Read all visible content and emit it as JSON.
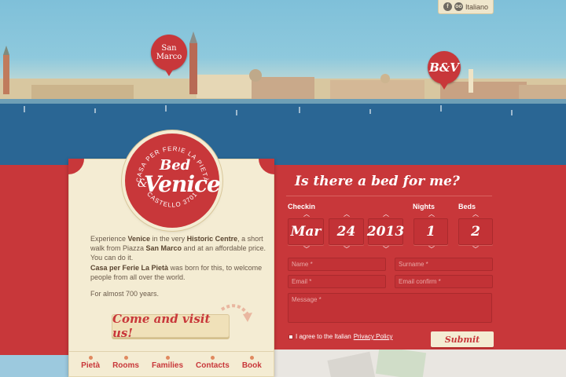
{
  "header": {
    "language": "Italiano",
    "social": [
      {
        "icon": "facebook-icon",
        "glyph": "f"
      },
      {
        "icon": "tripadvisor-icon",
        "glyph": "oo"
      }
    ]
  },
  "map_pins": {
    "san_marco": "San Marco",
    "bv": "B&V"
  },
  "logo": {
    "arc_top": "CASA PER FERIE LA PIETÀ",
    "bed": "Bed",
    "amp": "&",
    "venice": "Venice",
    "arc_bottom": "CASTELLO 3701"
  },
  "intro": {
    "p1_a": "Experience ",
    "p1_b": "Venice",
    "p1_c": " in the very ",
    "p1_d": "Historic Centre",
    "p1_e": ", a short walk from Piazza ",
    "p1_f": "San Marco",
    "p1_g": " and at an affordable price. You can do it.",
    "p2_a": "Casa per Ferie La Pietà",
    "p2_b": " was born for this, to welcome people from all over the world.",
    "p3": "For almost 700 years."
  },
  "cta_label": "Come and visit us!",
  "nav": [
    "Pietà",
    "Rooms",
    "Families",
    "Contacts",
    "Book"
  ],
  "form": {
    "title": "Is there a bed for me?",
    "labels": {
      "checkin": "Checkin",
      "nights": "Nights",
      "beds": "Beds"
    },
    "checkin_month": "Mar",
    "checkin_day": "24",
    "checkin_year": "2013",
    "nights": "1",
    "beds": "2",
    "name_ph": "Name *",
    "surname_ph": "Surname *",
    "email_ph": "Email *",
    "email_confirm_ph": "Email confirm *",
    "message_ph": "Message *",
    "agree_text": "I agree to the Italian ",
    "privacy_link": "Privacy Policy",
    "submit": "Submit"
  },
  "colors": {
    "brand_red": "#c8373a",
    "cream": "#f4ecd3",
    "accent_orange": "#e0895f"
  }
}
